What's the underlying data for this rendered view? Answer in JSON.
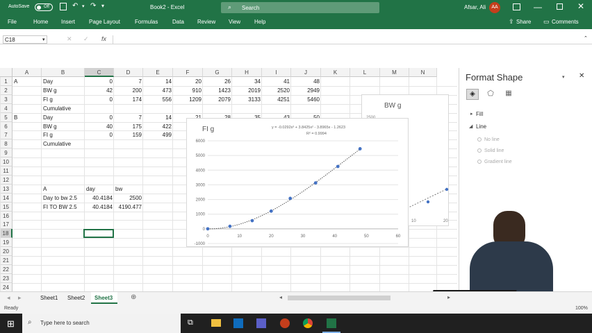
{
  "titlebar": {
    "autosave_label": "AutoSave",
    "autosave_state": "Off",
    "doc_title": "Book2 - Excel",
    "search_placeholder": "Search",
    "user_name": "Afsar, Ali",
    "user_initials": "AA"
  },
  "ribbon": {
    "tabs": [
      "File",
      "Home",
      "Insert",
      "Page Layout",
      "Formulas",
      "Data",
      "Review",
      "View",
      "Help"
    ],
    "share_label": "Share",
    "comments_label": "Comments"
  },
  "formula_bar": {
    "name_box": "C18",
    "fx_label": "fx",
    "content": ""
  },
  "grid": {
    "columns": [
      "A",
      "B",
      "C",
      "D",
      "E",
      "F",
      "G",
      "H",
      "I",
      "J",
      "K",
      "L",
      "M",
      "N"
    ],
    "rows": [
      "1",
      "2",
      "3",
      "4",
      "5",
      "6",
      "7",
      "8",
      "9",
      "10",
      "11",
      "12",
      "13",
      "14",
      "15",
      "16",
      "17",
      "18",
      "19",
      "20",
      "21",
      "22",
      "23",
      "24"
    ],
    "cells": {
      "A1": "A",
      "B1": "Day",
      "C1": "0",
      "D1": "7",
      "E1": "14",
      "F1": "20",
      "G1": "26",
      "H1": "34",
      "I1": "41",
      "J1": "48",
      "B2": "BW g",
      "C2": "42",
      "D2": "200",
      "E2": "473",
      "F2": "910",
      "G2": "1423",
      "H2": "2019",
      "I2": "2520",
      "J2": "2949",
      "B3": "FI g",
      "C3": "0",
      "D3": "174",
      "E3": "556",
      "F3": "1209",
      "G3": "2079",
      "H3": "3133",
      "I3": "4251",
      "J3": "5460",
      "B4": "Cumulative",
      "A5": "B",
      "B5": "Day",
      "C5": "0",
      "D5": "7",
      "E5": "14",
      "F5": "21",
      "G5": "28",
      "H5": "35",
      "I5": "43",
      "J5": "50",
      "B6": "BW g",
      "C6": "40",
      "D6": "175",
      "E6": "422",
      "B7": "FI g",
      "C7": "0",
      "D7": "159",
      "E7": "499",
      "B8": "Cumulative",
      "B13": "A",
      "C13": "day",
      "D13": "bw",
      "B14": "Day to bw 2.5",
      "C14": "40.4184",
      "D14": "2500",
      "B15": "FI TO BW 2.5",
      "C15": "40.4184",
      "D15": "4190.477"
    }
  },
  "chart_bw": {
    "title": "BW g",
    "partial_tick": "2500",
    "x_ticks": [
      "10",
      "20"
    ]
  },
  "chart_data": {
    "type": "scatter",
    "title": "FI g",
    "xlabel": "",
    "ylabel": "",
    "xlim": [
      0,
      60
    ],
    "ylim": [
      -1000,
      6000
    ],
    "x_ticks": [
      0,
      10,
      20,
      30,
      40,
      50,
      60
    ],
    "y_ticks": [
      -1000,
      0,
      1000,
      2000,
      3000,
      4000,
      5000,
      6000
    ],
    "grid": true,
    "trendline": "polynomial (dotted)",
    "equation": "y = -0.0292x³ + 3.8425x² - 3.8965x - 1.2623",
    "r_squared": "R² = 0.9994",
    "series": [
      {
        "x": [
          0,
          7,
          14,
          20,
          26,
          34,
          41,
          48
        ],
        "y": [
          0,
          174,
          556,
          1209,
          2079,
          3133,
          4251,
          5460
        ]
      }
    ]
  },
  "format_pane": {
    "title": "Format Shape",
    "sections": {
      "fill": "Fill",
      "line": "Line"
    },
    "line_options": [
      "No line",
      "Solid line",
      "Gradient line"
    ]
  },
  "sheets": {
    "tabs": [
      "Sheet1",
      "Sheet2",
      "Sheet3"
    ],
    "active": "Sheet3"
  },
  "status": {
    "ready": "Ready",
    "zoom": "100%"
  },
  "taskbar": {
    "search_placeholder": "Type here to search"
  },
  "colors": {
    "excel_green": "#217346",
    "marker_blue": "#4472c4"
  }
}
